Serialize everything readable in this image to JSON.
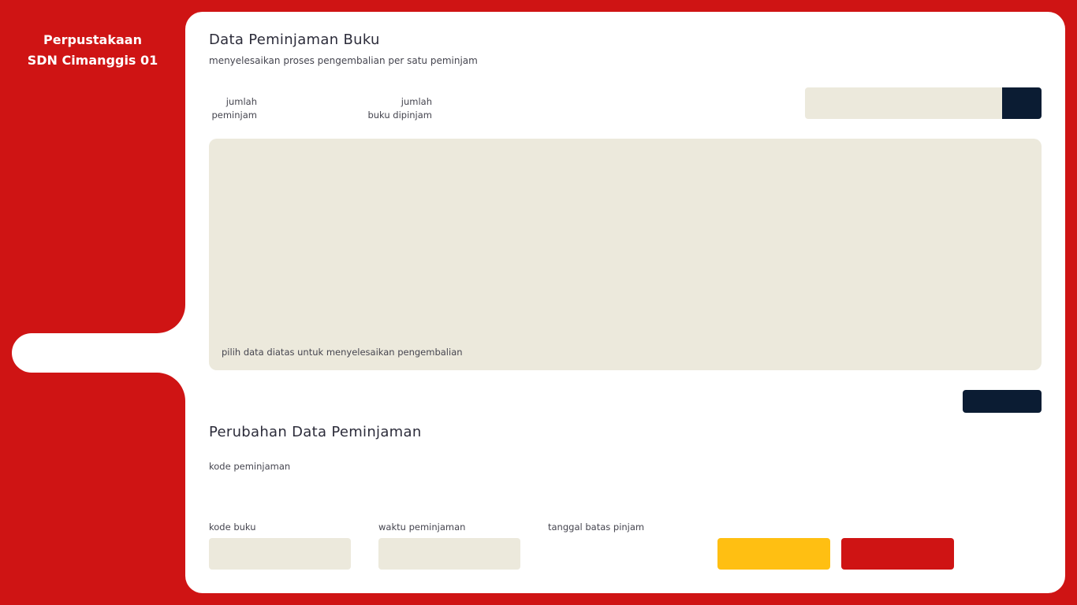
{
  "sidebar": {
    "brand_line1": "Perpustakaan",
    "brand_line2": "SDN Cimanggis 01"
  },
  "header": {
    "title": "Data Peminjaman Buku",
    "subtitle": "menyelesaikan proses pengembalian per satu peminjam"
  },
  "stats": {
    "peminjam_label": "jumlah\npeminjam",
    "buku_label": "jumlah\nbuku dipinjam"
  },
  "search": {
    "value": "",
    "placeholder": ""
  },
  "panel": {
    "hint": "pilih data diatas untuk menyelesaikan pengembalian"
  },
  "edit_section": {
    "title": "Perubahan Data Peminjaman",
    "kode_peminjaman_label": "kode peminjaman",
    "kode_buku_label": "kode buku",
    "waktu_peminjaman_label": "waktu peminjaman",
    "tanggal_batas_label": "tanggal batas pinjam"
  },
  "colors": {
    "primary_red": "#cf1414",
    "navy": "#0b1c33",
    "yellow": "#ffbf12",
    "panel_beige": "#ece9dc",
    "surface": "#ffffff"
  },
  "icons": {
    "search_button": "search-icon"
  }
}
